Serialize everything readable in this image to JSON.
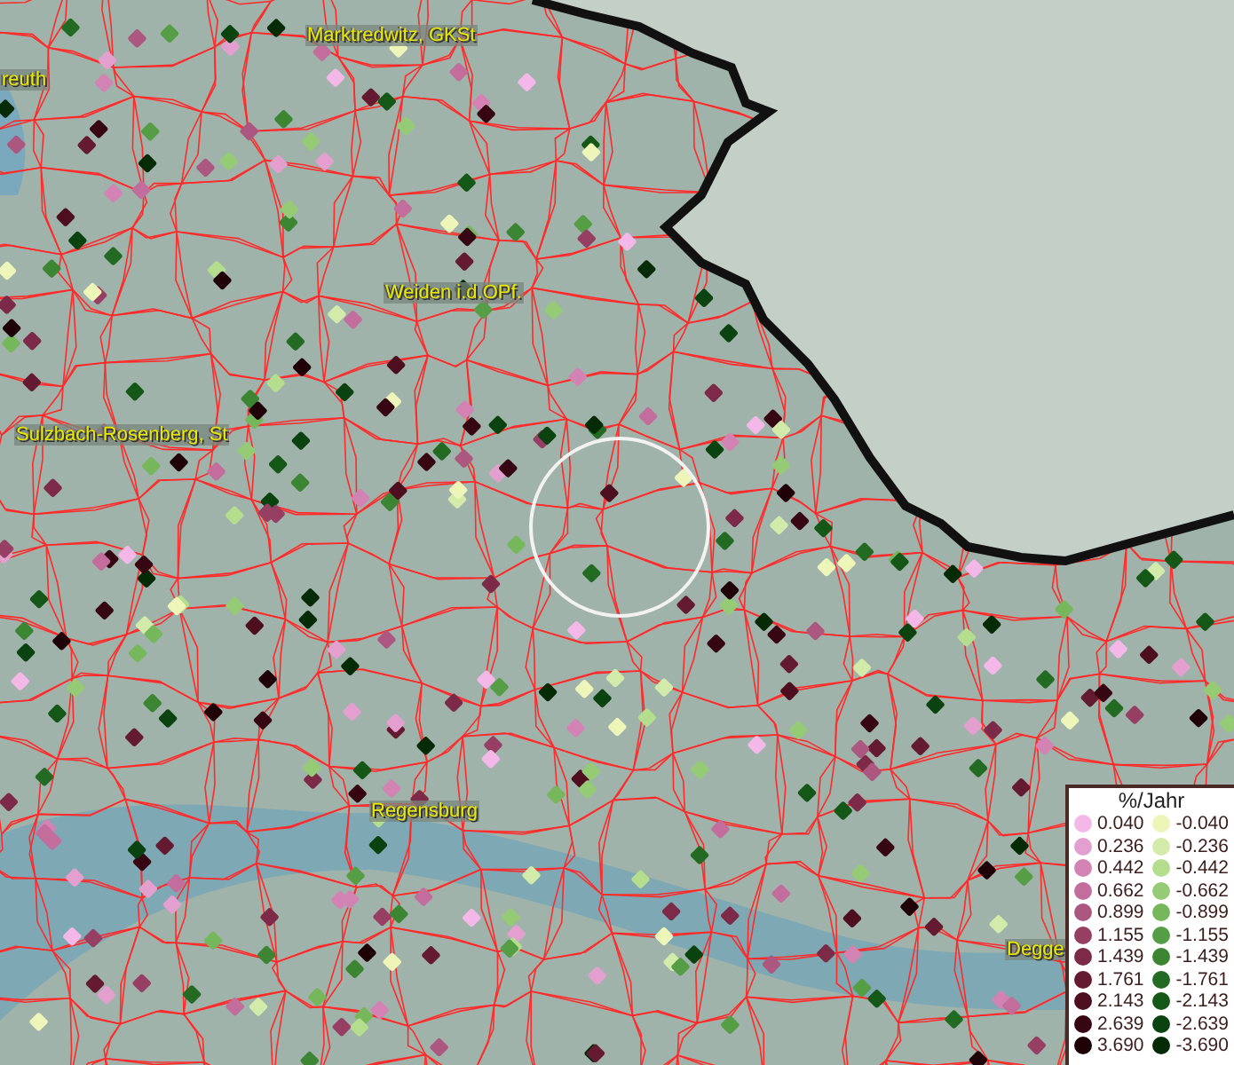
{
  "map": {
    "labels": [
      {
        "text": "Marktredwitz, GKSt"
      },
      {
        "text": "reuth"
      },
      {
        "text": "Weiden i.d.OPf."
      },
      {
        "text": "Sulzbach-Rosenberg, St"
      },
      {
        "text": "Regensburg"
      },
      {
        "text": "Degge"
      }
    ]
  },
  "legend": {
    "title": "%/Jahr",
    "columns": [
      {
        "entries": [
          {
            "value": "0.040",
            "color": "#f4b8e8"
          },
          {
            "value": "0.236",
            "color": "#e3a0cf"
          },
          {
            "value": "0.442",
            "color": "#d283b3"
          },
          {
            "value": "0.662",
            "color": "#c26d9b"
          },
          {
            "value": "0.899",
            "color": "#ac5780"
          },
          {
            "value": "1.155",
            "color": "#963f63"
          },
          {
            "value": "1.439",
            "color": "#7d2a48"
          },
          {
            "value": "1.761",
            "color": "#641a30"
          },
          {
            "value": "2.143",
            "color": "#4d0f1f"
          },
          {
            "value": "2.639",
            "color": "#360712"
          },
          {
            "value": "3.690",
            "color": "#1f0208"
          }
        ]
      },
      {
        "entries": [
          {
            "value": "-0.040",
            "color": "#eef5b8"
          },
          {
            "value": "-0.236",
            "color": "#d3ebaa"
          },
          {
            "value": "-0.442",
            "color": "#b5dd8e"
          },
          {
            "value": "-0.662",
            "color": "#95cb74"
          },
          {
            "value": "-0.899",
            "color": "#76b75c"
          },
          {
            "value": "-1.155",
            "color": "#569e46"
          },
          {
            "value": "-1.439",
            "color": "#3b8533"
          },
          {
            "value": "-1.761",
            "color": "#236b22"
          },
          {
            "value": "-2.143",
            "color": "#145716"
          },
          {
            "value": "-2.639",
            "color": "#0b4310"
          },
          {
            "value": "-3.690",
            "color": "#042b06"
          }
        ]
      }
    ]
  }
}
